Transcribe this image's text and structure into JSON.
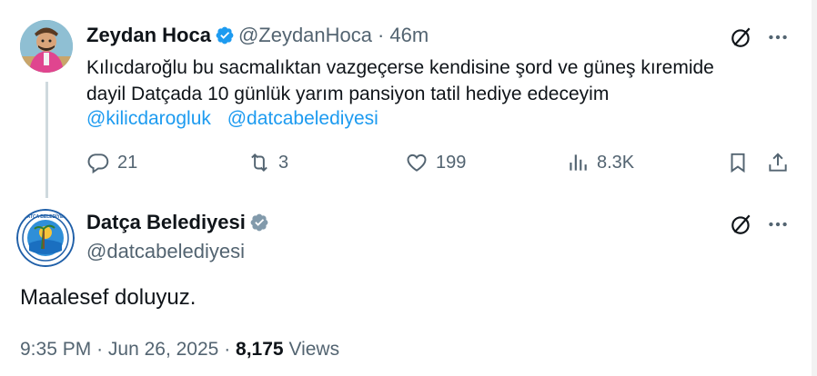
{
  "tweet": {
    "author_name": "Zeydan Hoca",
    "author_handle": "@ZeydanHoca",
    "time_separator": "·",
    "time": "46m",
    "text_line1": "Kılıcdaroğlu bu sacmalıktan  vazgeçerse  kendisine şord ve güneş kıremide",
    "text_line2": "dayil Datçada  10 günlük yarım pansiyon tatil hediye edeceyim",
    "mentions": [
      "@kilicdarogluk",
      "@datcabelediyesi"
    ],
    "actions": {
      "replies": "21",
      "reposts": "3",
      "likes": "199",
      "views": "8.3K"
    }
  },
  "reply": {
    "author_name": "Datça Belediyesi",
    "author_handle": "@datcabelediyesi",
    "text": "Maalesef doluyuz.",
    "time": "9:35 PM",
    "sep1": "·",
    "date": "Jun 26, 2025",
    "sep2": "·",
    "views_count": "8,175",
    "views_label": "Views"
  },
  "icons": {
    "verified_blue": "#1d9bf0",
    "verified_gray": "#829aab",
    "grok_icon": "grok-icon",
    "more_icon": "more-icon"
  },
  "colors": {
    "text": "#0f1419",
    "secondary": "#536471",
    "link": "#1d9bf0"
  }
}
